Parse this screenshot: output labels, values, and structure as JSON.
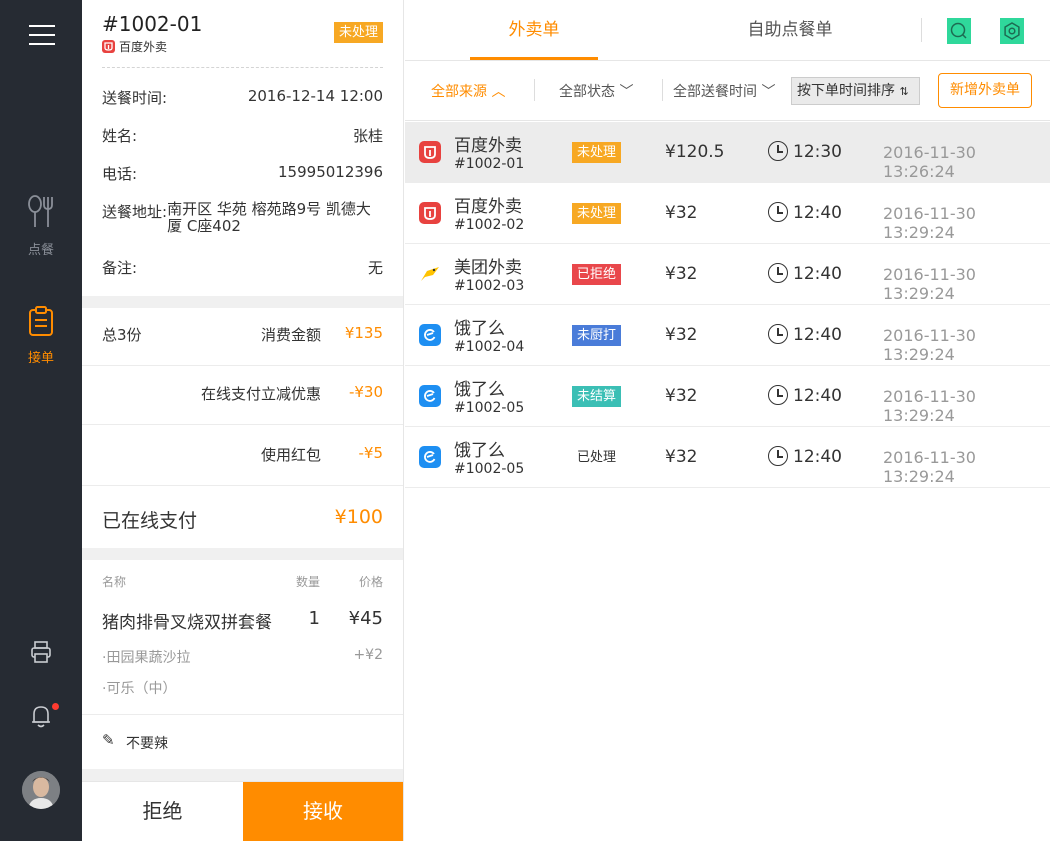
{
  "sidebar": {
    "items": [
      {
        "label": "点餐",
        "icon": "fork-knife-icon"
      },
      {
        "label": "接单",
        "icon": "clipboard-icon"
      }
    ],
    "accent": "#ff8c00"
  },
  "detail": {
    "order_no": "#1002-01",
    "source": "百度外卖",
    "status": "未处理",
    "fields": {
      "delivery_time_label": "送餐时间:",
      "delivery_time": "2016-12-14 12:00",
      "name_label": "姓名:",
      "name": "张桂",
      "phone_label": "电话:",
      "phone": "15995012396",
      "address_label": "送餐地址:",
      "address": "南开区 华苑 榕苑路9号 凯德大厦 C座402",
      "remark_label": "备注:",
      "remark": "无"
    },
    "summary": {
      "count": "总3份",
      "total_label": "消费金额",
      "total": "¥135",
      "discount_label": "在线支付立减优惠",
      "discount": "-¥30",
      "redpack_label": "使用红包",
      "redpack": "-¥5",
      "paid_label": "已在线支付",
      "paid": "¥100"
    },
    "items_header": {
      "name": "名称",
      "qty": "数量",
      "price": "价格"
    },
    "item": {
      "name": "猪肉排骨叉烧双拼套餐",
      "qty": "1",
      "price": "¥45"
    },
    "sub_items": [
      {
        "name": "·田园果蔬沙拉",
        "price": "+¥2"
      },
      {
        "name": "·可乐（中）",
        "price": ""
      }
    ],
    "note": "不要辣",
    "reject_label": "拒绝",
    "accept_label": "接收"
  },
  "tabs": [
    {
      "label": "外卖单",
      "active": true
    },
    {
      "label": "自助点餐单",
      "active": false
    }
  ],
  "filters": {
    "source": "全部来源",
    "status": "全部状态",
    "time": "全部送餐时间",
    "sort": "按下单时间排序",
    "add": "新增外卖单"
  },
  "orders": [
    {
      "source": "百度外卖",
      "num": "#1002-01",
      "status": "未处理",
      "status_type": "orange",
      "price": "¥120.5",
      "time": "12:30",
      "created": "2016-11-30 13:26:24",
      "logo": "baidu"
    },
    {
      "source": "百度外卖",
      "num": "#1002-02",
      "status": "未处理",
      "status_type": "orange",
      "price": "¥32",
      "time": "12:40",
      "created": "2016-11-30 13:29:24",
      "logo": "baidu"
    },
    {
      "source": "美团外卖",
      "num": "#1002-03",
      "status": "已拒绝",
      "status_type": "red",
      "price": "¥32",
      "time": "12:40",
      "created": "2016-11-30 13:29:24",
      "logo": "meituan"
    },
    {
      "source": "饿了么",
      "num": "#1002-04",
      "status": "未厨打",
      "status_type": "blue",
      "price": "¥32",
      "time": "12:40",
      "created": "2016-11-30 13:29:24",
      "logo": "eleme"
    },
    {
      "source": "饿了么",
      "num": "#1002-05",
      "status": "未结算",
      "status_type": "teal",
      "price": "¥32",
      "time": "12:40",
      "created": "2016-11-30 13:29:24",
      "logo": "eleme"
    },
    {
      "source": "饿了么",
      "num": "#1002-05",
      "status": "已处理",
      "status_type": "plain",
      "price": "¥32",
      "time": "12:40",
      "created": "2016-11-30 13:29:24",
      "logo": "eleme"
    }
  ]
}
